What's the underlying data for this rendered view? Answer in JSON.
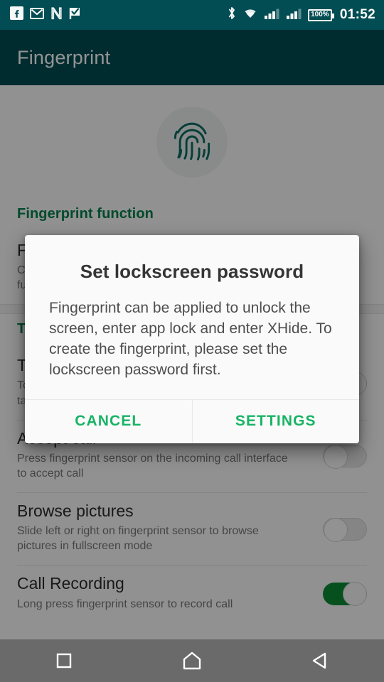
{
  "status_bar": {
    "left_icons": [
      {
        "name": "facebook-icon",
        "glyph": "f"
      },
      {
        "name": "gmail-icon",
        "glyph": "M"
      },
      {
        "name": "netflix-icon",
        "glyph": "N"
      },
      {
        "name": "tasks-check-flag-icon",
        "glyph": "check-flag"
      }
    ],
    "right_icons": [
      {
        "name": "bluetooth-icon"
      },
      {
        "name": "wifi-icon"
      },
      {
        "name": "signal-sim1-icon"
      },
      {
        "name": "signal-sim2-icon"
      }
    ],
    "battery_percent": "100%",
    "clock": "01:52"
  },
  "app_bar": {
    "title": "Fingerprint"
  },
  "hero": {
    "icon_name": "fingerprint-icon",
    "icon_color": "#0c6b61",
    "circle_color": "#eceff0"
  },
  "sections": [
    {
      "header": "Fingerprint function",
      "rows": [
        {
          "title": "Fingerprint management",
          "subtitle": "Create and manage fingerprints, set fingerprint functions",
          "toggle": null
        }
      ]
    },
    {
      "header": "Touch function",
      "rows": [
        {
          "title": "Take photo",
          "subtitle": "Touch fingerprint sensor on the camera interface to take photo",
          "toggle": "on"
        },
        {
          "title": "Accept call",
          "subtitle": "Press fingerprint sensor on the incoming call interface to accept call",
          "toggle": "off"
        },
        {
          "title": "Browse pictures",
          "subtitle": "Slide left or right on fingerprint sensor to browse pictures in fullscreen mode",
          "toggle": "off"
        },
        {
          "title": "Call Recording",
          "subtitle": "Long press fingerprint sensor to record call",
          "toggle": "on"
        }
      ]
    }
  ],
  "dialog": {
    "title": "Set lockscreen password",
    "message": "Fingerprint can be applied to unlock the screen, enter app lock and enter XHide. To create the fingerprint, please set the lockscreen password first.",
    "cancel_label": "CANCEL",
    "settings_label": "SETTINGS",
    "accent_color": "#17b464"
  },
  "nav_bar": {
    "recents_label": "recents",
    "home_label": "home",
    "back_label": "back"
  },
  "theme": {
    "status_bar_color": "#014d53",
    "app_bar_color": "#014d53",
    "section_header_color": "#00804a",
    "toggle_on_color": "#0b8a34",
    "scrim_color": "rgba(0,0,0,0.42)"
  }
}
